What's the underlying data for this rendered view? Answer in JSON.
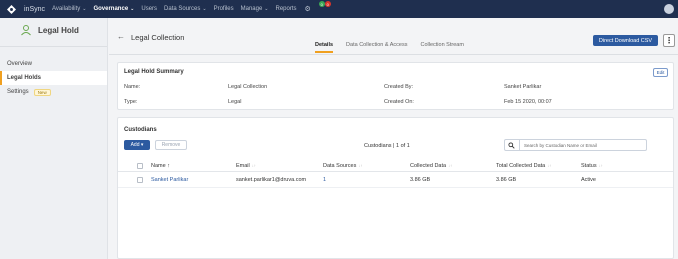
{
  "nav": {
    "brand": "inSync",
    "items": [
      {
        "label": "Availability",
        "caret": true,
        "active": false
      },
      {
        "label": "Governance",
        "caret": true,
        "active": true
      },
      {
        "label": "Users",
        "caret": false,
        "active": false
      },
      {
        "label": "Data Sources",
        "caret": true,
        "active": false
      },
      {
        "label": "Profiles",
        "caret": false,
        "active": false
      },
      {
        "label": "Manage",
        "caret": true,
        "active": false
      },
      {
        "label": "Reports",
        "caret": false,
        "active": false
      }
    ],
    "badge_green": "0",
    "badge_red": "0"
  },
  "sidebar": {
    "title": "Legal Hold",
    "items": [
      {
        "label": "Overview"
      },
      {
        "label": "Legal Holds"
      },
      {
        "label": "Settings",
        "tag": "New"
      }
    ]
  },
  "header": {
    "title": "Legal Collection",
    "tabs": [
      "Details",
      "Data Collection & Access",
      "Collection Stream"
    ],
    "download_label": "Direct Download CSV",
    "more_label": "⋮"
  },
  "summary": {
    "title": "Legal Hold Summary",
    "edit_label": "Edit",
    "name_label": "Name:",
    "name_value": "Legal Collection",
    "type_label": "Type:",
    "type_value": "Legal",
    "created_by_label": "Created By:",
    "created_by_value": "Sanket Parlikar",
    "created_on_label": "Created On:",
    "created_on_value": "Feb 15 2020, 00:07"
  },
  "custodians": {
    "title": "Custodians",
    "add_label": "Add ▾",
    "remove_label": "Remove",
    "count_text": "Custodians | 1 of 1",
    "search_placeholder": "Search by Custodian Name or Email",
    "columns": [
      "Name ↑",
      "Email",
      "Data Sources",
      "Collected Data",
      "Total Collected Data",
      "Status"
    ],
    "rows": [
      {
        "name": "Sanket Parlikar",
        "email": "sanket.parlikar1@druva.com",
        "data_sources": "1",
        "collected": "3.86 GB",
        "total": "3.86 GB",
        "status": "Active"
      }
    ]
  },
  "colors": {
    "nav_bg": "#1f2f4f",
    "accent": "#f0a020",
    "primary": "#2c5aa0"
  }
}
